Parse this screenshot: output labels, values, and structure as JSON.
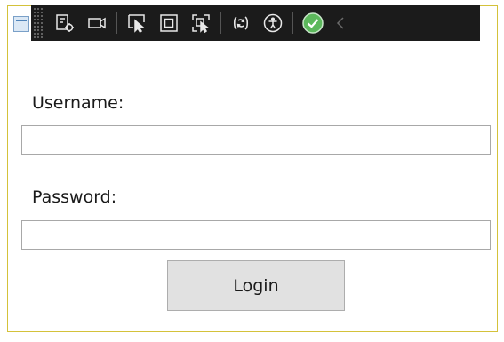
{
  "form": {
    "username_label": "Username:",
    "username_value": "",
    "password_label": "Password:",
    "password_value": "",
    "login_label": "Login"
  },
  "toolbar": {
    "items": [
      "live-visual-tree-icon",
      "record-icon",
      "select-element-icon",
      "display-layout-adorners-icon",
      "track-focused-element-icon",
      "hot-reload-icon",
      "accessibility-checker-icon",
      "status-ok-icon",
      "collapse-chevron-icon"
    ],
    "status_color": "#5cb85c"
  },
  "colors": {
    "window_border": "#d4c23a",
    "toolbar_bg": "#1b1b1b",
    "button_bg": "#e1e1e1"
  }
}
